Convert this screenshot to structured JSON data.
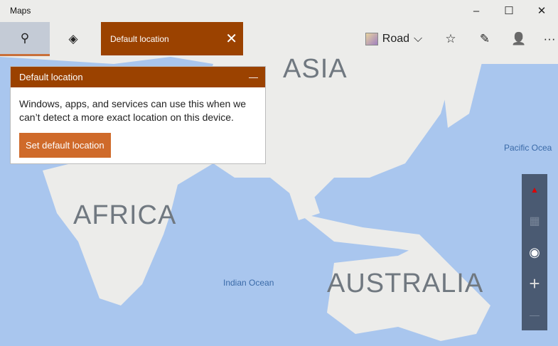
{
  "window": {
    "title": "Maps",
    "minimize": "–",
    "maximize": "☐",
    "close": "✕"
  },
  "toolbar": {
    "search_icon": "⚲",
    "directions_icon": "◈",
    "tab_label": "Default location",
    "tab_close": "✕",
    "map_style": "Road",
    "chevron": "⌵",
    "favorites_icon": "☆",
    "ink_icon": "✎",
    "account_icon": "👤",
    "more": "···"
  },
  "panel": {
    "title": "Default location",
    "collapse": "—",
    "body": "Windows, apps, and services can use this when we can’t detect a more exact location on this device.",
    "button": "Set default location"
  },
  "map": {
    "labels": {
      "asia": "ASIA",
      "africa": "AFRICA",
      "australia": "AUSTRALIA",
      "pacific": "Pacific Ocea",
      "indian": "Indian Ocean"
    }
  },
  "controls": {
    "compass": "▲",
    "tilt": "▦",
    "locate": "◉",
    "zoom_in": "+",
    "zoom_out": "—"
  }
}
